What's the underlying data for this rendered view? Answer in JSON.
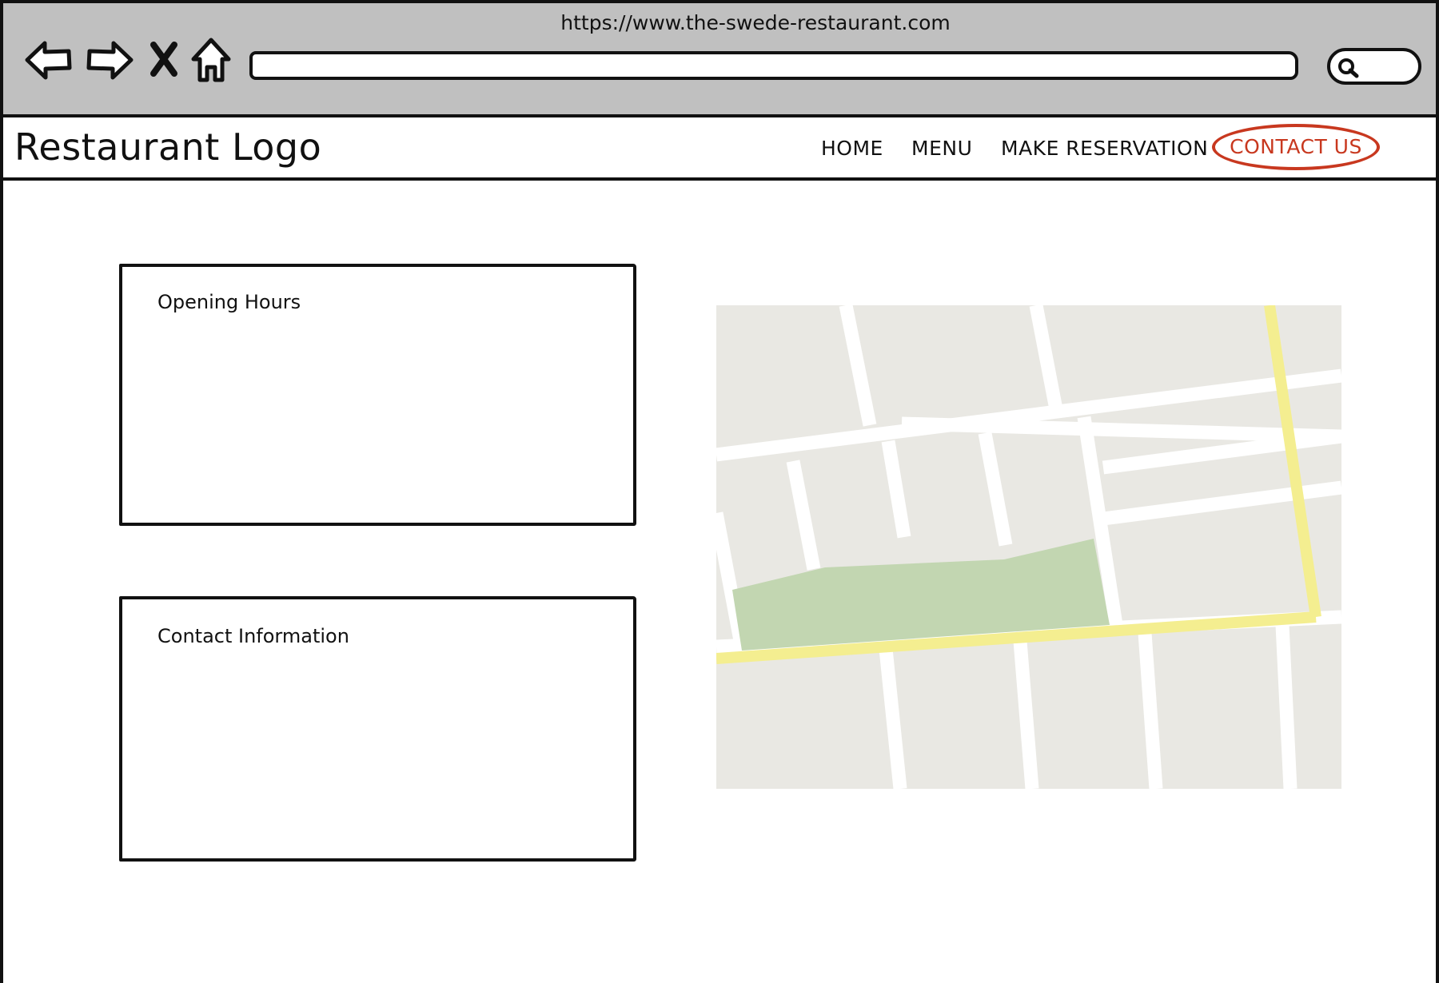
{
  "browser": {
    "url": "https://www.the-swede-restaurant.com",
    "icons": [
      "back-arrow-icon",
      "forward-arrow-icon",
      "stop-icon",
      "home-icon",
      "search-icon"
    ]
  },
  "header": {
    "logo": "Restaurant Logo",
    "nav": {
      "home": "HOME",
      "menu": "MENU",
      "reservation": "MAKE RESERVATION",
      "contact": "CONTACT US"
    },
    "active_color": "#c8381f"
  },
  "main": {
    "opening_hours_title": "Opening Hours",
    "contact_info_title": "Contact Information"
  },
  "map": {
    "colors": {
      "block": "#e9e8e3",
      "road": "#ffffff",
      "park": "#c2d6b1",
      "highlight_road": "#f4ee90"
    }
  }
}
